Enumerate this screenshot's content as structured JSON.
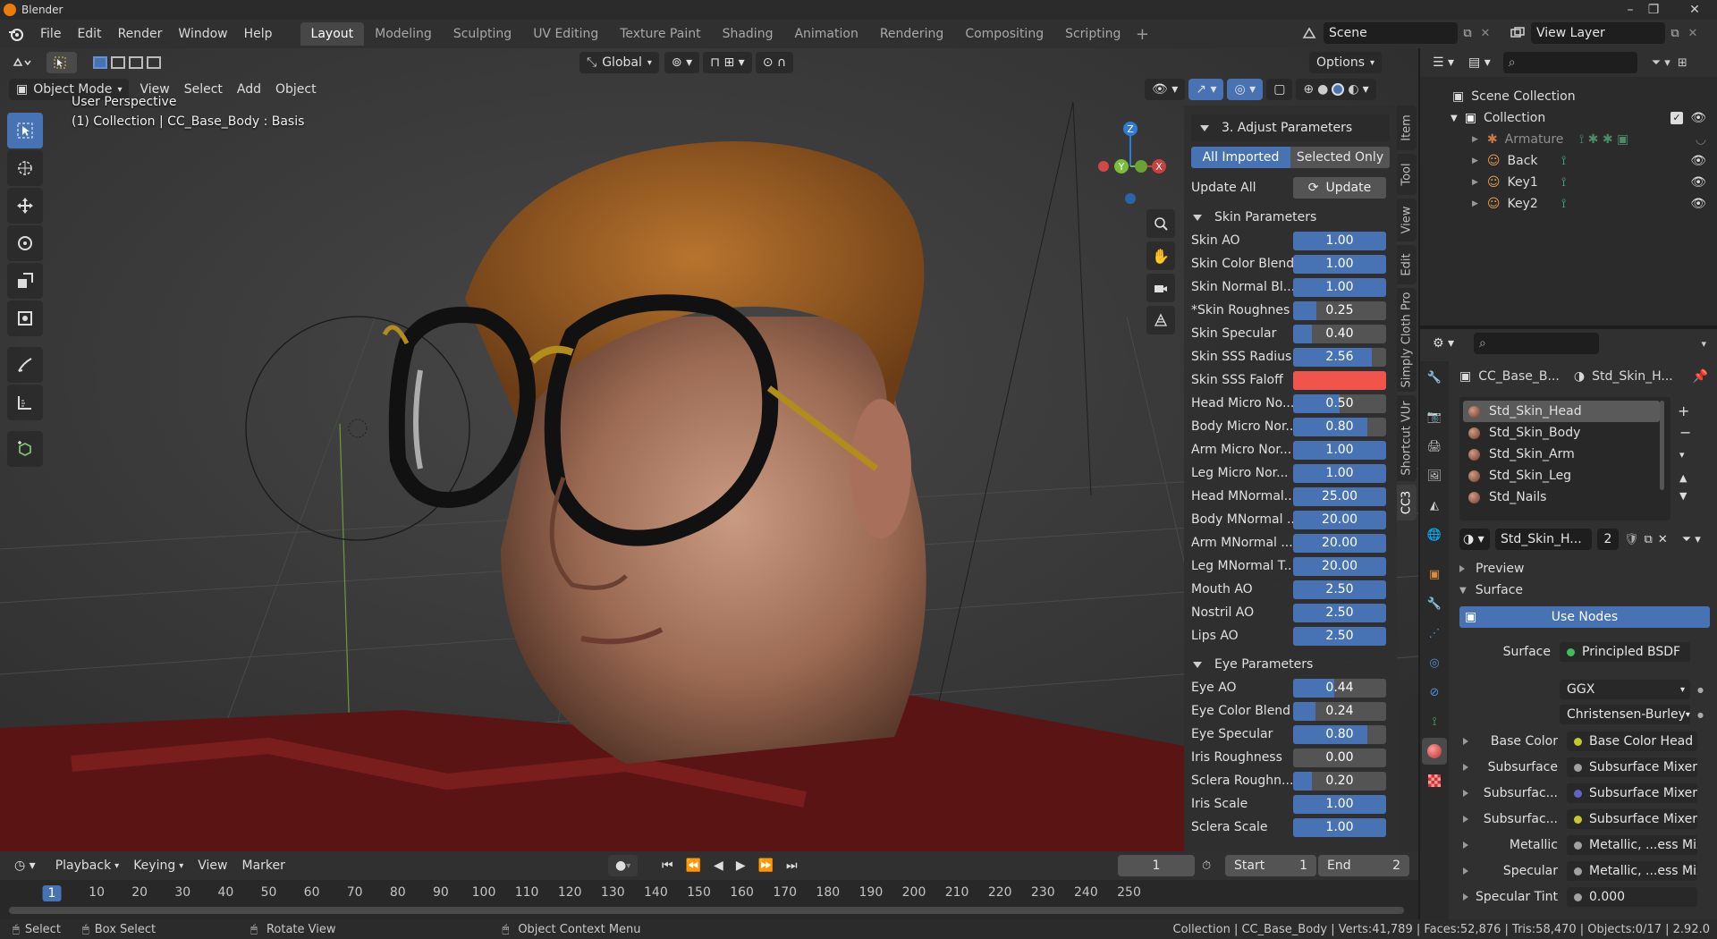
{
  "window": {
    "title": "Blender"
  },
  "menu": [
    "File",
    "Edit",
    "Render",
    "Window",
    "Help"
  ],
  "workspaces": [
    "Layout",
    "Modeling",
    "Sculpting",
    "UV Editing",
    "Texture Paint",
    "Shading",
    "Animation",
    "Rendering",
    "Compositing",
    "Scripting"
  ],
  "workspace_add": "+",
  "scene": {
    "name": "Scene",
    "view_layer": "View Layer"
  },
  "viewport": {
    "mode": "Object Mode",
    "menus": [
      "View",
      "Select",
      "Add",
      "Object"
    ],
    "orientation": "Global",
    "options_label": "Options",
    "perspective": "User Perspective",
    "context": "(1) Collection | CC_Base_Body : Basis",
    "gizmo": {
      "z": "Z",
      "y": "Y",
      "x": "X"
    }
  },
  "npanel": {
    "header": "3. Adjust Parameters",
    "tab_all": "All Imported",
    "tab_selected": "Selected Only",
    "update_all_label": "Update All",
    "update_button": "Update",
    "skin_header": "Skin Parameters",
    "skin": [
      {
        "label": "Skin AO",
        "value": "1.00",
        "fill": 1.0
      },
      {
        "label": "Skin Color Blend",
        "value": "1.00",
        "fill": 1.0
      },
      {
        "label": "Skin Normal Bl...",
        "value": "1.00",
        "fill": 1.0
      },
      {
        "label": "*Skin Roughnes",
        "value": "0.25",
        "fill": 0.25
      },
      {
        "label": "Skin Specular",
        "value": "0.40",
        "fill": 0.2
      },
      {
        "label": "Skin SSS Radius",
        "value": "2.56",
        "fill": 0.85
      },
      {
        "label": "Skin SSS Faloff",
        "value": "",
        "fill": 1.0,
        "color": "#f0544a"
      },
      {
        "label": "Head Micro No...",
        "value": "0.50",
        "fill": 0.5
      },
      {
        "label": "Body Micro Nor...",
        "value": "0.80",
        "fill": 0.8
      },
      {
        "label": "Arm Micro Nor...",
        "value": "1.00",
        "fill": 1.0
      },
      {
        "label": "Leg Micro Nor...",
        "value": "1.00",
        "fill": 1.0
      },
      {
        "label": "Head MNormal...",
        "value": "25.00",
        "fill": 1.0
      },
      {
        "label": "Body MNormal ...",
        "value": "20.00",
        "fill": 1.0
      },
      {
        "label": "Arm MNormal ...",
        "value": "20.00",
        "fill": 1.0
      },
      {
        "label": "Leg MNormal T...",
        "value": "20.00",
        "fill": 1.0
      },
      {
        "label": "Mouth AO",
        "value": "2.50",
        "fill": 1.0
      },
      {
        "label": "Nostril AO",
        "value": "2.50",
        "fill": 1.0
      },
      {
        "label": "Lips AO",
        "value": "2.50",
        "fill": 1.0
      }
    ],
    "eye_header": "Eye Parameters",
    "eye": [
      {
        "label": "Eye AO",
        "value": "0.44",
        "fill": 0.44
      },
      {
        "label": "Eye Color Blend",
        "value": "0.24",
        "fill": 0.24
      },
      {
        "label": "Eye Specular",
        "value": "0.80",
        "fill": 0.8
      },
      {
        "label": "Iris Roughness",
        "value": "0.00",
        "fill": 0.0
      },
      {
        "label": "Sclera Roughn...",
        "value": "0.20",
        "fill": 0.2
      },
      {
        "label": "Iris Scale",
        "value": "1.00",
        "fill": 1.0
      },
      {
        "label": "Sclera Scale",
        "value": "1.00",
        "fill": 1.0
      }
    ],
    "side_tabs": [
      "Item",
      "Tool",
      "View",
      "Edit",
      "Simply Cloth Pro",
      "Shortcut VUr",
      "CC3"
    ]
  },
  "timeline": {
    "menus": [
      "Playback",
      "Keying",
      "View",
      "Marker"
    ],
    "current_frame": "1",
    "start_label": "Start",
    "start": "1",
    "end_label": "End",
    "end": "2",
    "ticks": [
      "1",
      "10",
      "20",
      "30",
      "40",
      "50",
      "60",
      "70",
      "80",
      "90",
      "100",
      "110",
      "120",
      "130",
      "140",
      "150",
      "160",
      "170",
      "180",
      "190",
      "200",
      "210",
      "220",
      "230",
      "240",
      "250"
    ]
  },
  "outliner": {
    "root": "Scene Collection",
    "collection": "Collection",
    "items": [
      "Armature",
      "Back",
      "Key1",
      "Key2"
    ]
  },
  "properties": {
    "object_name": "CC_Base_B...",
    "material_name": "Std_Skin_H...",
    "materials": [
      "Std_Skin_Head",
      "Std_Skin_Body",
      "Std_Skin_Arm",
      "Std_Skin_Leg",
      "Std_Nails"
    ],
    "slot_name": "Std_Skin_H...",
    "slot_users": "2",
    "preview_label": "Preview",
    "surface_label": "Surface",
    "use_nodes": "Use Nodes",
    "surface_row": {
      "label": "Surface",
      "value": "Principled BSDF"
    },
    "distribution": "GGX",
    "subsurface_method": "Christensen-Burley",
    "inputs": [
      {
        "label": "Base Color",
        "value": "Base Color Head ...",
        "sock": "#c7c729"
      },
      {
        "label": "Subsurface",
        "value": "Subsurface Mixer",
        "sock": "#a1a1a1"
      },
      {
        "label": "Subsurfac...",
        "value": "Subsurface Mixer",
        "sock": "#6363c7"
      },
      {
        "label": "Subsurfac...",
        "value": "Subsurface Mixer",
        "sock": "#c7c729"
      },
      {
        "label": "Metallic",
        "value": "Metallic, ...ess Mixer",
        "sock": "#a1a1a1"
      },
      {
        "label": "Specular",
        "value": "Metallic, ...ess Mixer",
        "sock": "#a1a1a1"
      },
      {
        "label": "Specular Tint",
        "value": "0.000",
        "sock": "#a1a1a1"
      }
    ]
  },
  "statusbar": {
    "select": "Select",
    "box_select": "Box Select",
    "rotate_view": "Rotate View",
    "context_menu": "Object Context Menu",
    "stats": "Collection | CC_Base_Body | Verts:41,789 | Faces:52,876 | Tris:58,470 | Objects:0/17 | 2.92.0"
  },
  "colors": {
    "accent": "#4772b3",
    "falloff": "#f0544a",
    "brand": "#e87d0d"
  }
}
